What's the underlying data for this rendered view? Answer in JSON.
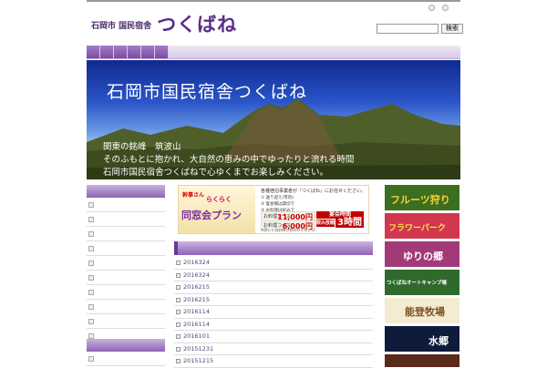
{
  "header": {
    "logo_small": "石岡市 国民宿舎",
    "logo_big": "つくばね",
    "search_placeholder": "",
    "search_button": "検索"
  },
  "nav": {
    "tabs": [
      "",
      "",
      "",
      "",
      "",
      ""
    ]
  },
  "hero": {
    "title": "石岡市国民宿舎つくばね",
    "lines": [
      "関東の銘峰　筑波山",
      "そのふもとに抱かれ、大自然の恵みの中でゆったりと流れる時間",
      "石岡市国民宿舎つくばねで心ゆくまでお楽しみください。"
    ]
  },
  "promo": {
    "badge": "幹事さん",
    "sub": "らくらく",
    "main": "同窓会プラン",
    "intro": "各種宿泊事業者が『つくばね』にお任せください。",
    "rows": [
      "① 送り迎え(市内)",
      "② 宴会場は貸切で",
      "③ お料理は好みで"
    ],
    "prices": [
      {
        "label": "お料理コース",
        "value": "11,000円"
      },
      {
        "label": "お料理コース",
        "value": "6,000円"
      }
    ],
    "red1_top": "宴会時間",
    "red1_bottom": "飲み放題",
    "red2": "3時間",
    "foot": "※詳しくはお問い合わせください"
  },
  "news": {
    "heading": "",
    "items": [
      "2016324",
      "2016324",
      "2016215",
      "2016215",
      "2016114",
      "2016114",
      "2016101",
      "20151231",
      "20151215"
    ]
  },
  "banners": [
    {
      "text": "フルーツ狩り",
      "color": "#3c6e1f",
      "accent": "#f5d23a"
    },
    {
      "text": "フラワーパーク",
      "color": "#d1374e",
      "accent": "#ffe34d"
    },
    {
      "text": "ゆりの郷",
      "color": "#a23a7a",
      "accent": "#ffffff"
    },
    {
      "text": "つくばねオートキャンプ場",
      "color": "#2f6a2c",
      "accent": "#ffffff"
    },
    {
      "text": "能登牧場",
      "color": "#f3ecd2",
      "accent": "#7a5020"
    },
    {
      "text": "水郷",
      "color": "#0e1b3a",
      "accent": "#ffffff"
    },
    {
      "text": "",
      "color": "#5a2a1a",
      "accent": "#ffffff"
    }
  ],
  "colors": {
    "accent": "#5b2d86",
    "nav": "#8d64b4"
  }
}
